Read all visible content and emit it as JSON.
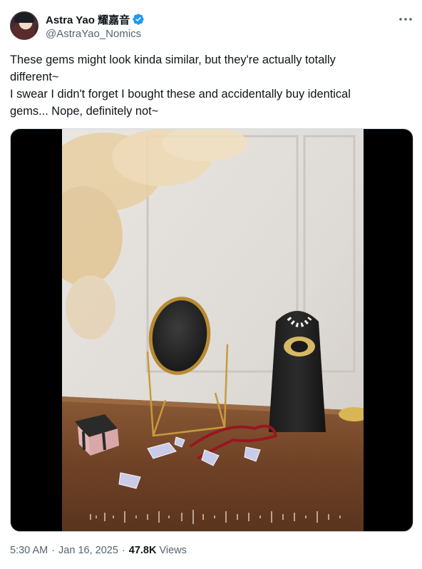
{
  "author": {
    "display_name": "Astra Yao 耀嘉音",
    "handle": "@AstraYao_Nomics",
    "verified": true,
    "verified_color": "#1d9bf0"
  },
  "tweet": {
    "lines": [
      "These gems might look kinda similar, but they're actually totally",
      "different~",
      "I swear I didn't forget I bought these and accidentally buy identical",
      "gems... Nope, definitely not~"
    ]
  },
  "meta": {
    "time": "5:30 AM",
    "date": "Jan 16, 2025",
    "separator": "·",
    "views_count": "47.8K",
    "views_label": "Views"
  },
  "icons": {
    "more": "more-horizontal-icon",
    "verified": "verified-badge-icon"
  },
  "colors": {
    "text": "#0f1419",
    "secondary": "#536471",
    "accent": "#1d9bf0"
  }
}
